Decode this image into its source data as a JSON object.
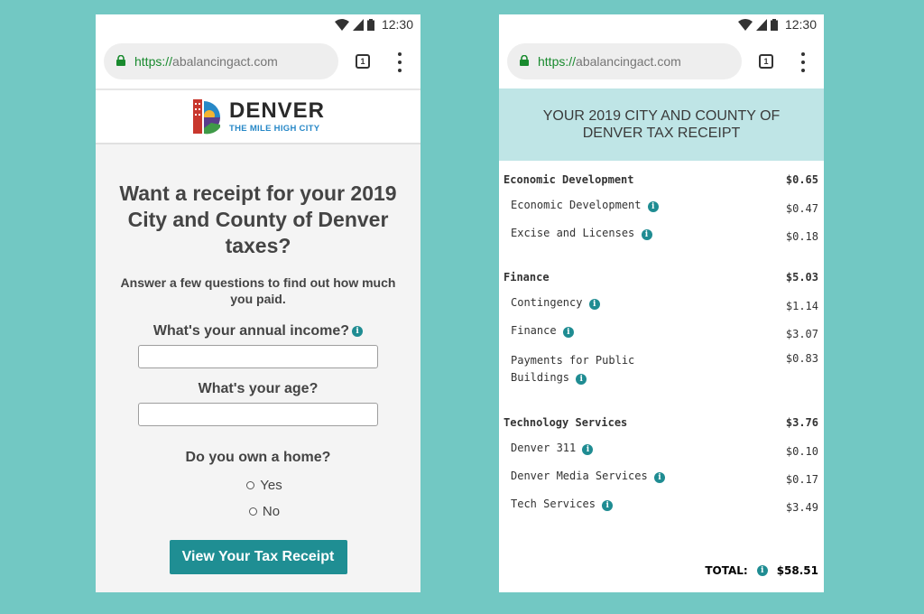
{
  "status_bar": {
    "time": "12:30"
  },
  "browser": {
    "url_scheme": "https://",
    "url_host": "abalancingact.com",
    "tab_count": "1"
  },
  "left": {
    "logo": {
      "title": "DENVER",
      "subtitle": "THE MILE HIGH CITY"
    },
    "title": "Want a receipt for your 2019 City and County of Denver taxes?",
    "subtitle": "Answer a few questions to find out how much you paid.",
    "income_label": "What's your annual income?",
    "age_label": "What's your age?",
    "home_label": "Do you own a home?",
    "options": [
      "Yes",
      "No"
    ],
    "button": "View Your Tax Receipt"
  },
  "right": {
    "header": "YOUR 2019 CITY AND COUNTY OF DENVER TAX RECEIPT",
    "categories": [
      {
        "name": "Economic Development",
        "amount": "$0.65",
        "items": [
          {
            "name": "Economic Development",
            "amount": "$0.47"
          },
          {
            "name": "Excise and Licenses",
            "amount": "$0.18"
          }
        ]
      },
      {
        "name": "Finance",
        "amount": "$5.03",
        "items": [
          {
            "name": "Contingency",
            "amount": "$1.14"
          },
          {
            "name": "Finance",
            "amount": "$3.07"
          },
          {
            "name": "Payments for Public Buildings",
            "amount": "$0.83"
          }
        ]
      },
      {
        "name": "Technology Services",
        "amount": "$3.76",
        "items": [
          {
            "name": "Denver 311",
            "amount": "$0.10"
          },
          {
            "name": "Denver Media Services",
            "amount": "$0.17"
          },
          {
            "name": "Tech Services",
            "amount": "$3.49"
          }
        ]
      }
    ],
    "total_label": "TOTAL:",
    "total_value": "$58.51"
  },
  "colors": {
    "background": "#72c8c3",
    "accent": "#1f8e93",
    "receipt_header": "#bfe5e6",
    "secure": "#198a2e"
  },
  "icons": [
    "wifi-icon",
    "signal-icon",
    "battery-icon",
    "lock-icon",
    "tabs-icon",
    "menu-icon",
    "info-icon"
  ]
}
